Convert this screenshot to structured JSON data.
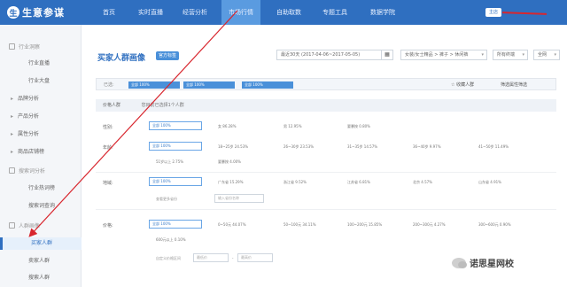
{
  "app": {
    "logo_text": "生意参谋",
    "logo_glyph": "生"
  },
  "nav": {
    "items": [
      "首页",
      "实时直播",
      "经营分析",
      "市场行情",
      "自助取数",
      "专题工具",
      "数据学院"
    ],
    "active_index": 3
  },
  "user": {
    "badge": "主店"
  },
  "sidebar": {
    "section_industry": "行业洞察",
    "items_industry": [
      "行业直播",
      "行业大盘"
    ],
    "expandable": [
      "品牌分析",
      "产品分析",
      "属性分析",
      "商品店铺榜"
    ],
    "section_search": "搜索词分析",
    "items_search": [
      "行业热词榜",
      "搜索词查询"
    ],
    "section_crowd": "人群画像",
    "items_crowd": [
      "买家人群",
      "卖家人群",
      "搜索人群"
    ],
    "selected": "买家人群"
  },
  "main": {
    "title": "买家人群画像",
    "title_tag": "官方标签",
    "date_range": "最近30天 (2017-04-06~2017-05-05)",
    "calendar_icon": "calendar-icon",
    "category_select": "女装/女士精品 > 裤子 > 休闲裤",
    "terminal_select": "所有终端",
    "channel_select": "全网"
  },
  "filter": {
    "label": "已选:",
    "chips": [
      "全部 100%",
      "全部 100%",
      "全部 100%"
    ],
    "fav_label": "☆ 收藏人群",
    "expand_label": "筛选属性筛选"
  },
  "info": {
    "label": "价格人群",
    "text": "您目前已选择1个人群"
  },
  "rows": {
    "gender": {
      "label": "性别:",
      "box": "全部 100%",
      "values": [
        "女 86.28%",
        "男 12.95%",
        "要暴按 0.80%"
      ]
    },
    "age": {
      "label": "年龄:",
      "box": "全部 100%",
      "values": [
        "18~25岁 24.53%",
        "26~30岁 23.53%",
        "31~35岁 14.57%",
        "36~40岁 9.97%",
        "41~50岁 11.49%"
      ],
      "values2": [
        "51岁以上 2.75%",
        "要暴按 4.00%"
      ]
    },
    "region": {
      "label": "地域:",
      "box": "全部 100%",
      "values": [
        "广东省 15.29%",
        "浙江省 9.52%",
        "江苏省 6.81%",
        "北京 4.57%",
        "山东省 4.91%"
      ],
      "more": "查看更多省份",
      "input_placeholder": "输入省份名称"
    },
    "price": {
      "label": "价格:",
      "box": "全部 100%",
      "values": [
        "0~50元 44.07%",
        "50~100元 34.11%",
        "100~200元 15.85%",
        "200~300元 4.27%",
        "300~600元 0.90%"
      ],
      "values2": [
        "600元以上 0.10%"
      ],
      "custom_label": "自定义价格区间",
      "min_placeholder": "最低价",
      "max_placeholder": "最高价"
    }
  },
  "watermark": {
    "text": "诺思星网校"
  },
  "colors": {
    "brand": "#2f6fc0",
    "arrow": "#d8262e"
  }
}
